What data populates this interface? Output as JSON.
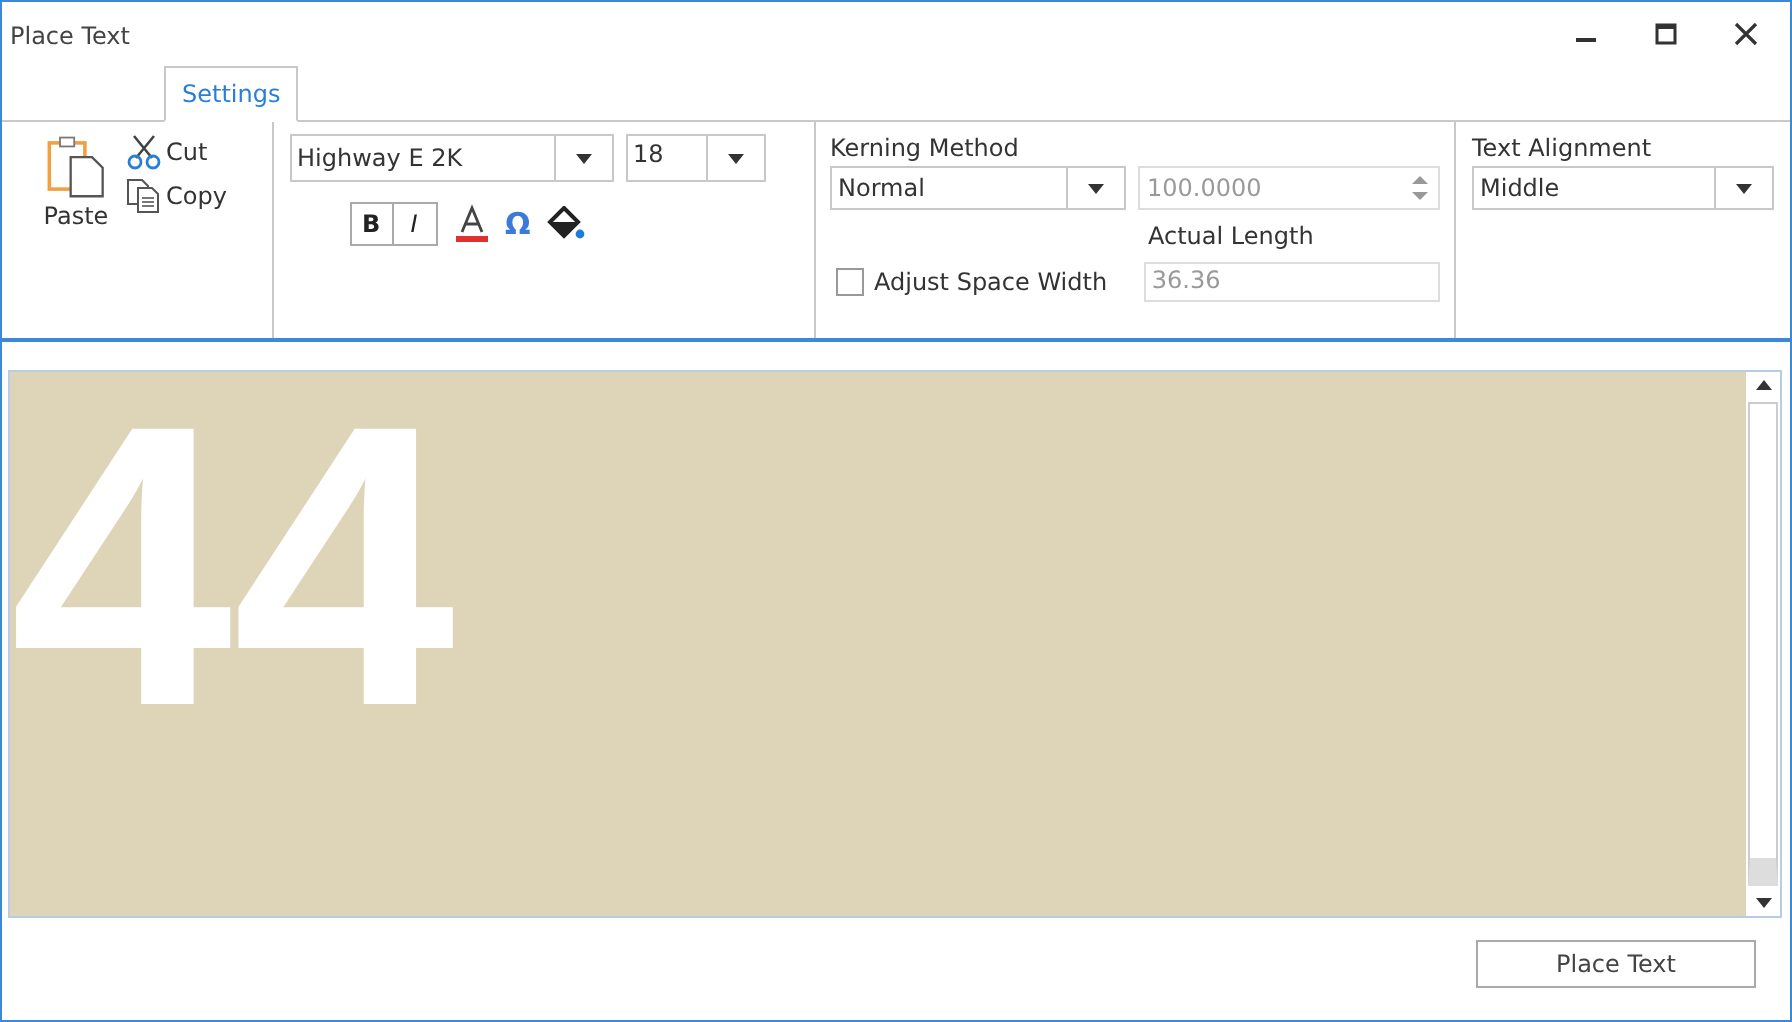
{
  "window": {
    "title": "Place Text"
  },
  "tabs": [
    {
      "label": "Settings",
      "selected": true
    }
  ],
  "clipboard": {
    "paste": "Paste",
    "cut": "Cut",
    "copy": "Copy"
  },
  "font": {
    "family": "Highway E 2K",
    "size": "18",
    "bold": {
      "label": "B",
      "pressed": false
    },
    "italic": {
      "label": "I",
      "pressed": false
    },
    "omega": "Ω"
  },
  "kerning": {
    "label": "Kerning Method",
    "method": "Normal",
    "value": "100.0000",
    "value_disabled": true,
    "actual_length_label": "Actual Length",
    "actual_length": "36.36",
    "actual_length_disabled": true,
    "adjust_space_width": {
      "label": "Adjust Space Width",
      "checked": false
    }
  },
  "alignment": {
    "label": "Text Alignment",
    "value": "Middle"
  },
  "preview": {
    "text": "44"
  },
  "footer": {
    "button": "Place Text"
  }
}
